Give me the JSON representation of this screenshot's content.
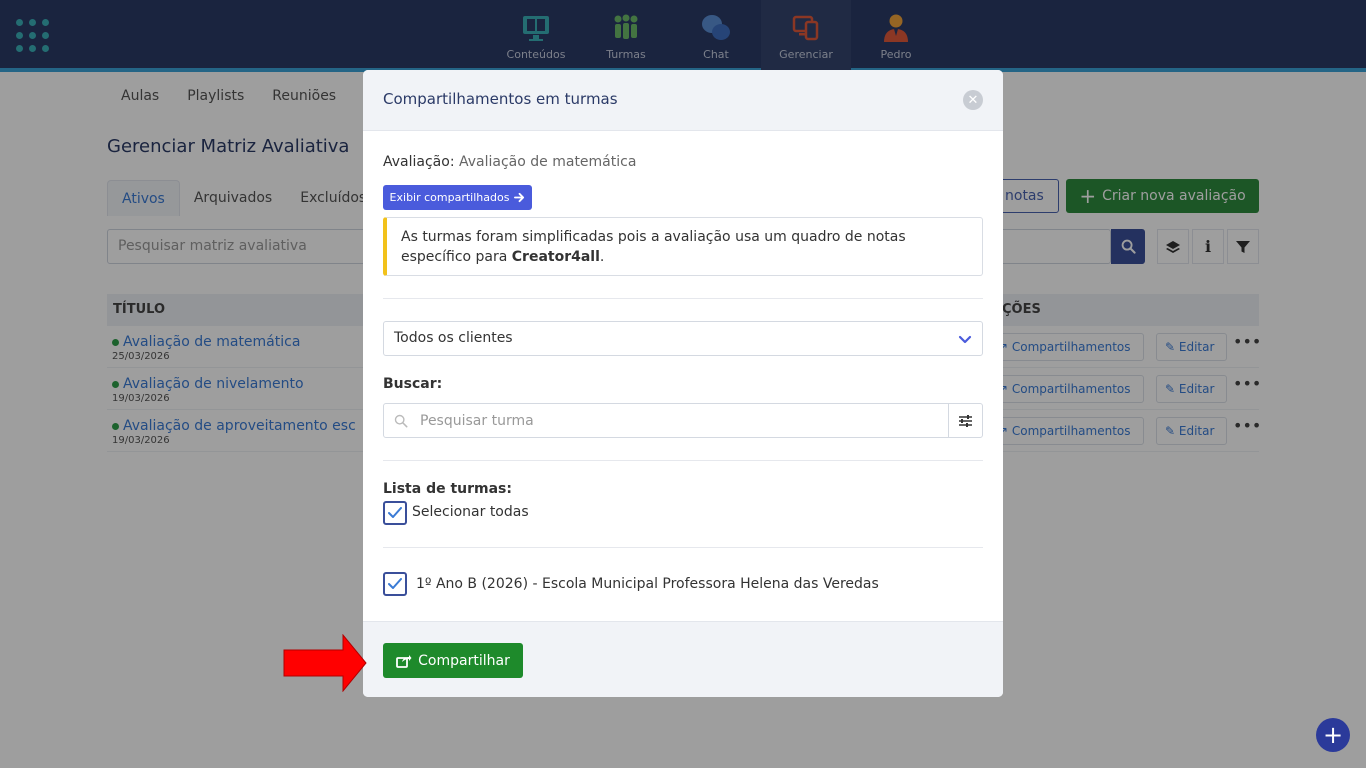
{
  "topbar": {
    "nav": [
      {
        "label": "Conteúdos",
        "icon": "monitor-book-icon"
      },
      {
        "label": "Turmas",
        "icon": "group-icon"
      },
      {
        "label": "Chat",
        "icon": "chat-bubbles-icon"
      },
      {
        "label": "Gerenciar",
        "icon": "manage-devices-icon"
      },
      {
        "label": "Pedro",
        "icon": "user-avatar-icon"
      }
    ]
  },
  "page": {
    "subnav": [
      "Aulas",
      "Playlists",
      "Reuniões"
    ],
    "title": "Gerenciar Matriz Avaliativa",
    "tabs": [
      "Ativos",
      "Arquivados",
      "Excluídos"
    ],
    "notas_button": "notas",
    "create_button": "Criar nova avaliação",
    "search_placeholder": "Pesquisar matriz avaliativa",
    "table": {
      "col_title": "TÍTULO",
      "col_actions": "ÇÕES",
      "share_label": "Compartilhamentos",
      "edit_label": "Editar",
      "more_label": "•••",
      "rows": [
        {
          "title": "Avaliação de matemática",
          "date": "25/03/2026"
        },
        {
          "title": "Avaliação de nivelamento",
          "date": "19/03/2026"
        },
        {
          "title": "Avaliação de aproveitamento esc",
          "date": "19/03/2026"
        }
      ]
    }
  },
  "modal": {
    "title": "Compartilhamentos em turmas",
    "eval_label": "Avaliação:",
    "eval_value": "Avaliação de matemática",
    "show_shared_button": "Exibir compartilhados",
    "alert_text_1": "As turmas foram simplificadas pois a avaliação usa um quadro de notas específico para ",
    "alert_bold": "Creator4all",
    "alert_text_2": ".",
    "client_select": "Todos os clientes",
    "search_label": "Buscar:",
    "search_placeholder": "Pesquisar turma",
    "list_label": "Lista de turmas:",
    "select_all": "Selecionar todas",
    "turma": "1º Ano B (2026) - Escola Municipal Professora Helena das Veredas",
    "share_button": "Compartilhar"
  },
  "colors": {
    "topbar": "#2b3a67",
    "accent_green": "#1e8a2b",
    "accent_blue": "#4a5bdc",
    "alert_yellow": "#f2c21b",
    "arrow_red": "#ff0000"
  }
}
